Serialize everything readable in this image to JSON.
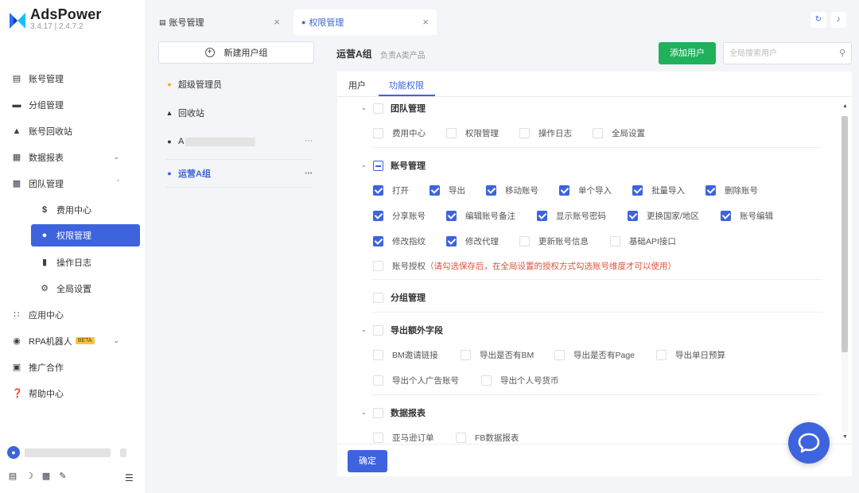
{
  "app": {
    "name": "AdsPower",
    "version": "3.4.17 | 2.4.7.2"
  },
  "sidebar": {
    "items": [
      {
        "label": "账号管理",
        "icon": "list-icon"
      },
      {
        "label": "分组管理",
        "icon": "folder-icon"
      },
      {
        "label": "账号回收站",
        "icon": "trash-icon"
      },
      {
        "label": "数据报表",
        "icon": "chart-icon"
      },
      {
        "label": "团队管理",
        "icon": "team-icon"
      },
      {
        "label": "费用中心",
        "icon": "dollar-icon"
      },
      {
        "label": "权限管理",
        "icon": "users-icon"
      },
      {
        "label": "操作日志",
        "icon": "file-icon"
      },
      {
        "label": "全局设置",
        "icon": "gear-icon"
      },
      {
        "label": "应用中心",
        "icon": "apps-icon"
      },
      {
        "label": "RPA机器人",
        "icon": "robot-icon",
        "badge": "BETA"
      },
      {
        "label": "推广合作",
        "icon": "promo-icon"
      },
      {
        "label": "帮助中心",
        "icon": "help-icon"
      }
    ]
  },
  "tabs": [
    {
      "label": "账号管理"
    },
    {
      "label": "权限管理"
    }
  ],
  "groups": {
    "new_group_label": "新建用户组",
    "items": [
      {
        "label": "超级管理员"
      },
      {
        "label": "回收站"
      },
      {
        "label": "A"
      },
      {
        "label": "运营A组"
      }
    ]
  },
  "header": {
    "group_title": "运营A组",
    "group_desc": "负责A类产品",
    "add_user_label": "添加用户",
    "search_placeholder": "全局搜索用户"
  },
  "content_tabs": [
    {
      "label": "用户"
    },
    {
      "label": "功能权限"
    }
  ],
  "permissions": {
    "team": {
      "title": "团队管理",
      "items": [
        "费用中心",
        "权限管理",
        "操作日志",
        "全局设置"
      ]
    },
    "account": {
      "title": "账号管理",
      "row1": [
        "打开",
        "导出",
        "移动账号",
        "单个导入",
        "批量导入",
        "删除账号"
      ],
      "row2": [
        "分享账号",
        "编辑账号备注",
        "显示账号密码",
        "更换国家/地区",
        "账号编辑"
      ],
      "row3": [
        "修改指纹",
        "修改代理",
        "更新账号信息",
        "基础API接口"
      ],
      "auth_label": "账号授权",
      "auth_note": "（请勾选保存后，在全局设置的授权方式勾选账号维度才可以使用）"
    },
    "group": {
      "title": "分组管理"
    },
    "export": {
      "title": "导出额外字段",
      "row1": [
        "BM邀请链接",
        "导出是否有BM",
        "导出是否有Page",
        "导出单日预算"
      ],
      "row2": [
        "导出个人广告账号",
        "导出个人号货币"
      ]
    },
    "report": {
      "title": "数据报表",
      "items": [
        "亚马逊订单",
        "FB数据报表"
      ]
    }
  },
  "footer": {
    "confirm_label": "确定"
  }
}
